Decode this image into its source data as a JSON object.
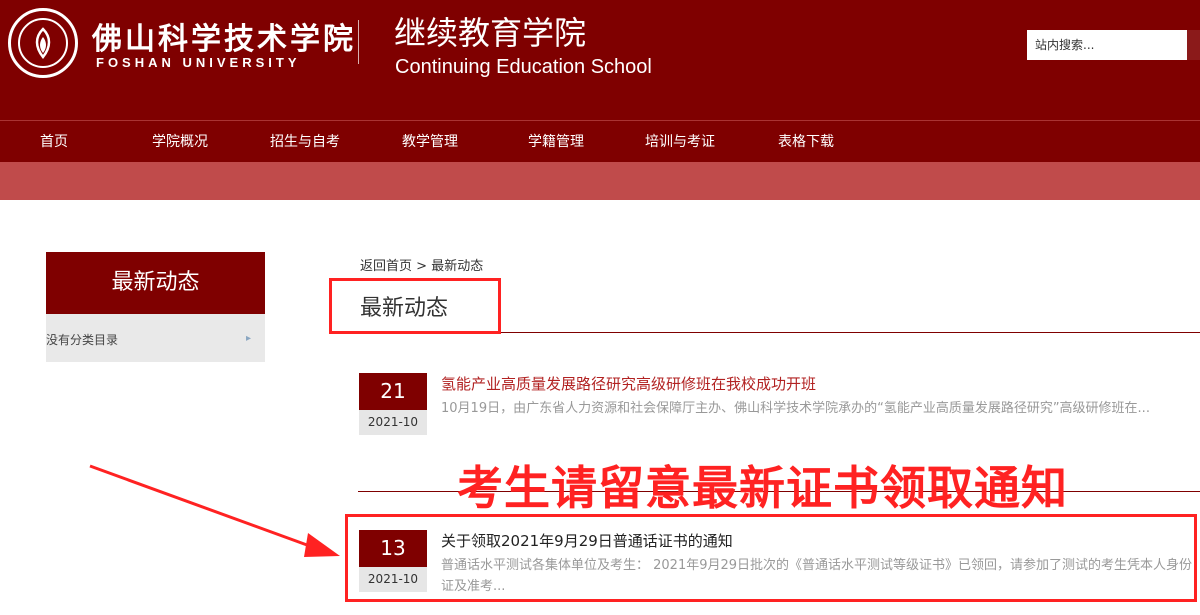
{
  "header": {
    "university_cn": "佛山科学技术学院",
    "university_en": "FOSHAN UNIVERSITY",
    "school_cn": "继续教育学院",
    "school_en": "Continuing Education School",
    "search_placeholder": "站内搜索..."
  },
  "nav": {
    "items": [
      {
        "label": "首页"
      },
      {
        "label": "学院概况"
      },
      {
        "label": "招生与自考"
      },
      {
        "label": "教学管理"
      },
      {
        "label": "学籍管理"
      },
      {
        "label": "培训与考证"
      },
      {
        "label": "表格下载"
      }
    ]
  },
  "sidebar": {
    "heading": "最新动态",
    "items": [
      {
        "label": "没有分类目录"
      }
    ]
  },
  "breadcrumb": {
    "home": "返回首页",
    "separator": ">",
    "current": "最新动态"
  },
  "page_title": "最新动态",
  "news": [
    {
      "day": "21",
      "year_month": "2021-10",
      "title": "氢能产业高质量发展路径研究高级研修班在我校成功开班",
      "summary": "10月19日，由广东省人力资源和社会保障厅主办、佛山科学技术学院承办的“氢能产业高质量发展路径研究”高级研修班在..."
    },
    {
      "day": "13",
      "year_month": "2021-10",
      "title": "关于领取2021年9月29日普通话证书的通知",
      "summary": "普通话水平测试各集体单位及考生：       2021年9月29日批次的《普通话水平测试等级证书》已领回，请参加了测试的考生凭本人身份证及准考..."
    }
  ],
  "annotation": {
    "text": "考生请留意最新证书领取通知",
    "color": "#ff2222"
  },
  "colors": {
    "brand": "#7f0000",
    "band": "#c04b4b",
    "news_title_1": "#b22222",
    "news_title_2": "#222222"
  }
}
